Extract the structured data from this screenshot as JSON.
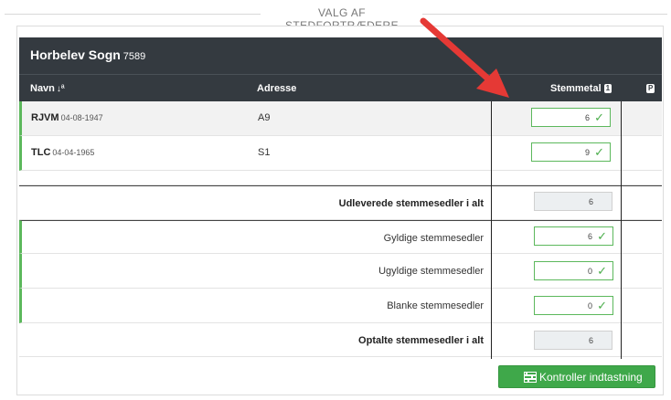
{
  "section": {
    "legend": "VALG AF STEDFORTRÆDERE"
  },
  "header": {
    "title": "Horbelev Sogn",
    "code": "7589"
  },
  "columns": {
    "name": "Navn",
    "sort_icon": "↓ª",
    "address": "Adresse",
    "votes": "Stemmetal",
    "votes_badge": "1",
    "p_badge": "P"
  },
  "candidates": [
    {
      "name": "RJVM",
      "dob": "04-08-1947",
      "address": "A9",
      "votes": "6"
    },
    {
      "name": "TLC",
      "dob": "04-04-1965",
      "address": "S1",
      "votes": "9"
    }
  ],
  "summary": {
    "distributed": {
      "label": "Udleverede stemmesedler i alt",
      "value": "6"
    },
    "valid": {
      "label": "Gyldige stemmesedler",
      "value": "6"
    },
    "invalid": {
      "label": "Ugyldige stemmesedler",
      "value": "0"
    },
    "blank": {
      "label": "Blanke stemmesedler",
      "value": "0"
    },
    "counted": {
      "label": "Optalte stemmesedler i alt",
      "value": "6"
    }
  },
  "actions": {
    "check_label": "Kontroller indtastning"
  },
  "icons": {
    "check": "check-icon",
    "sort": "sort-icon",
    "button": "sliders-icon",
    "annotation": "red-arrow"
  },
  "colors": {
    "header_bg": "#343a40",
    "accent_green": "#5cb85c",
    "button_green": "#3fa84a",
    "arrow_red": "#e53935"
  }
}
